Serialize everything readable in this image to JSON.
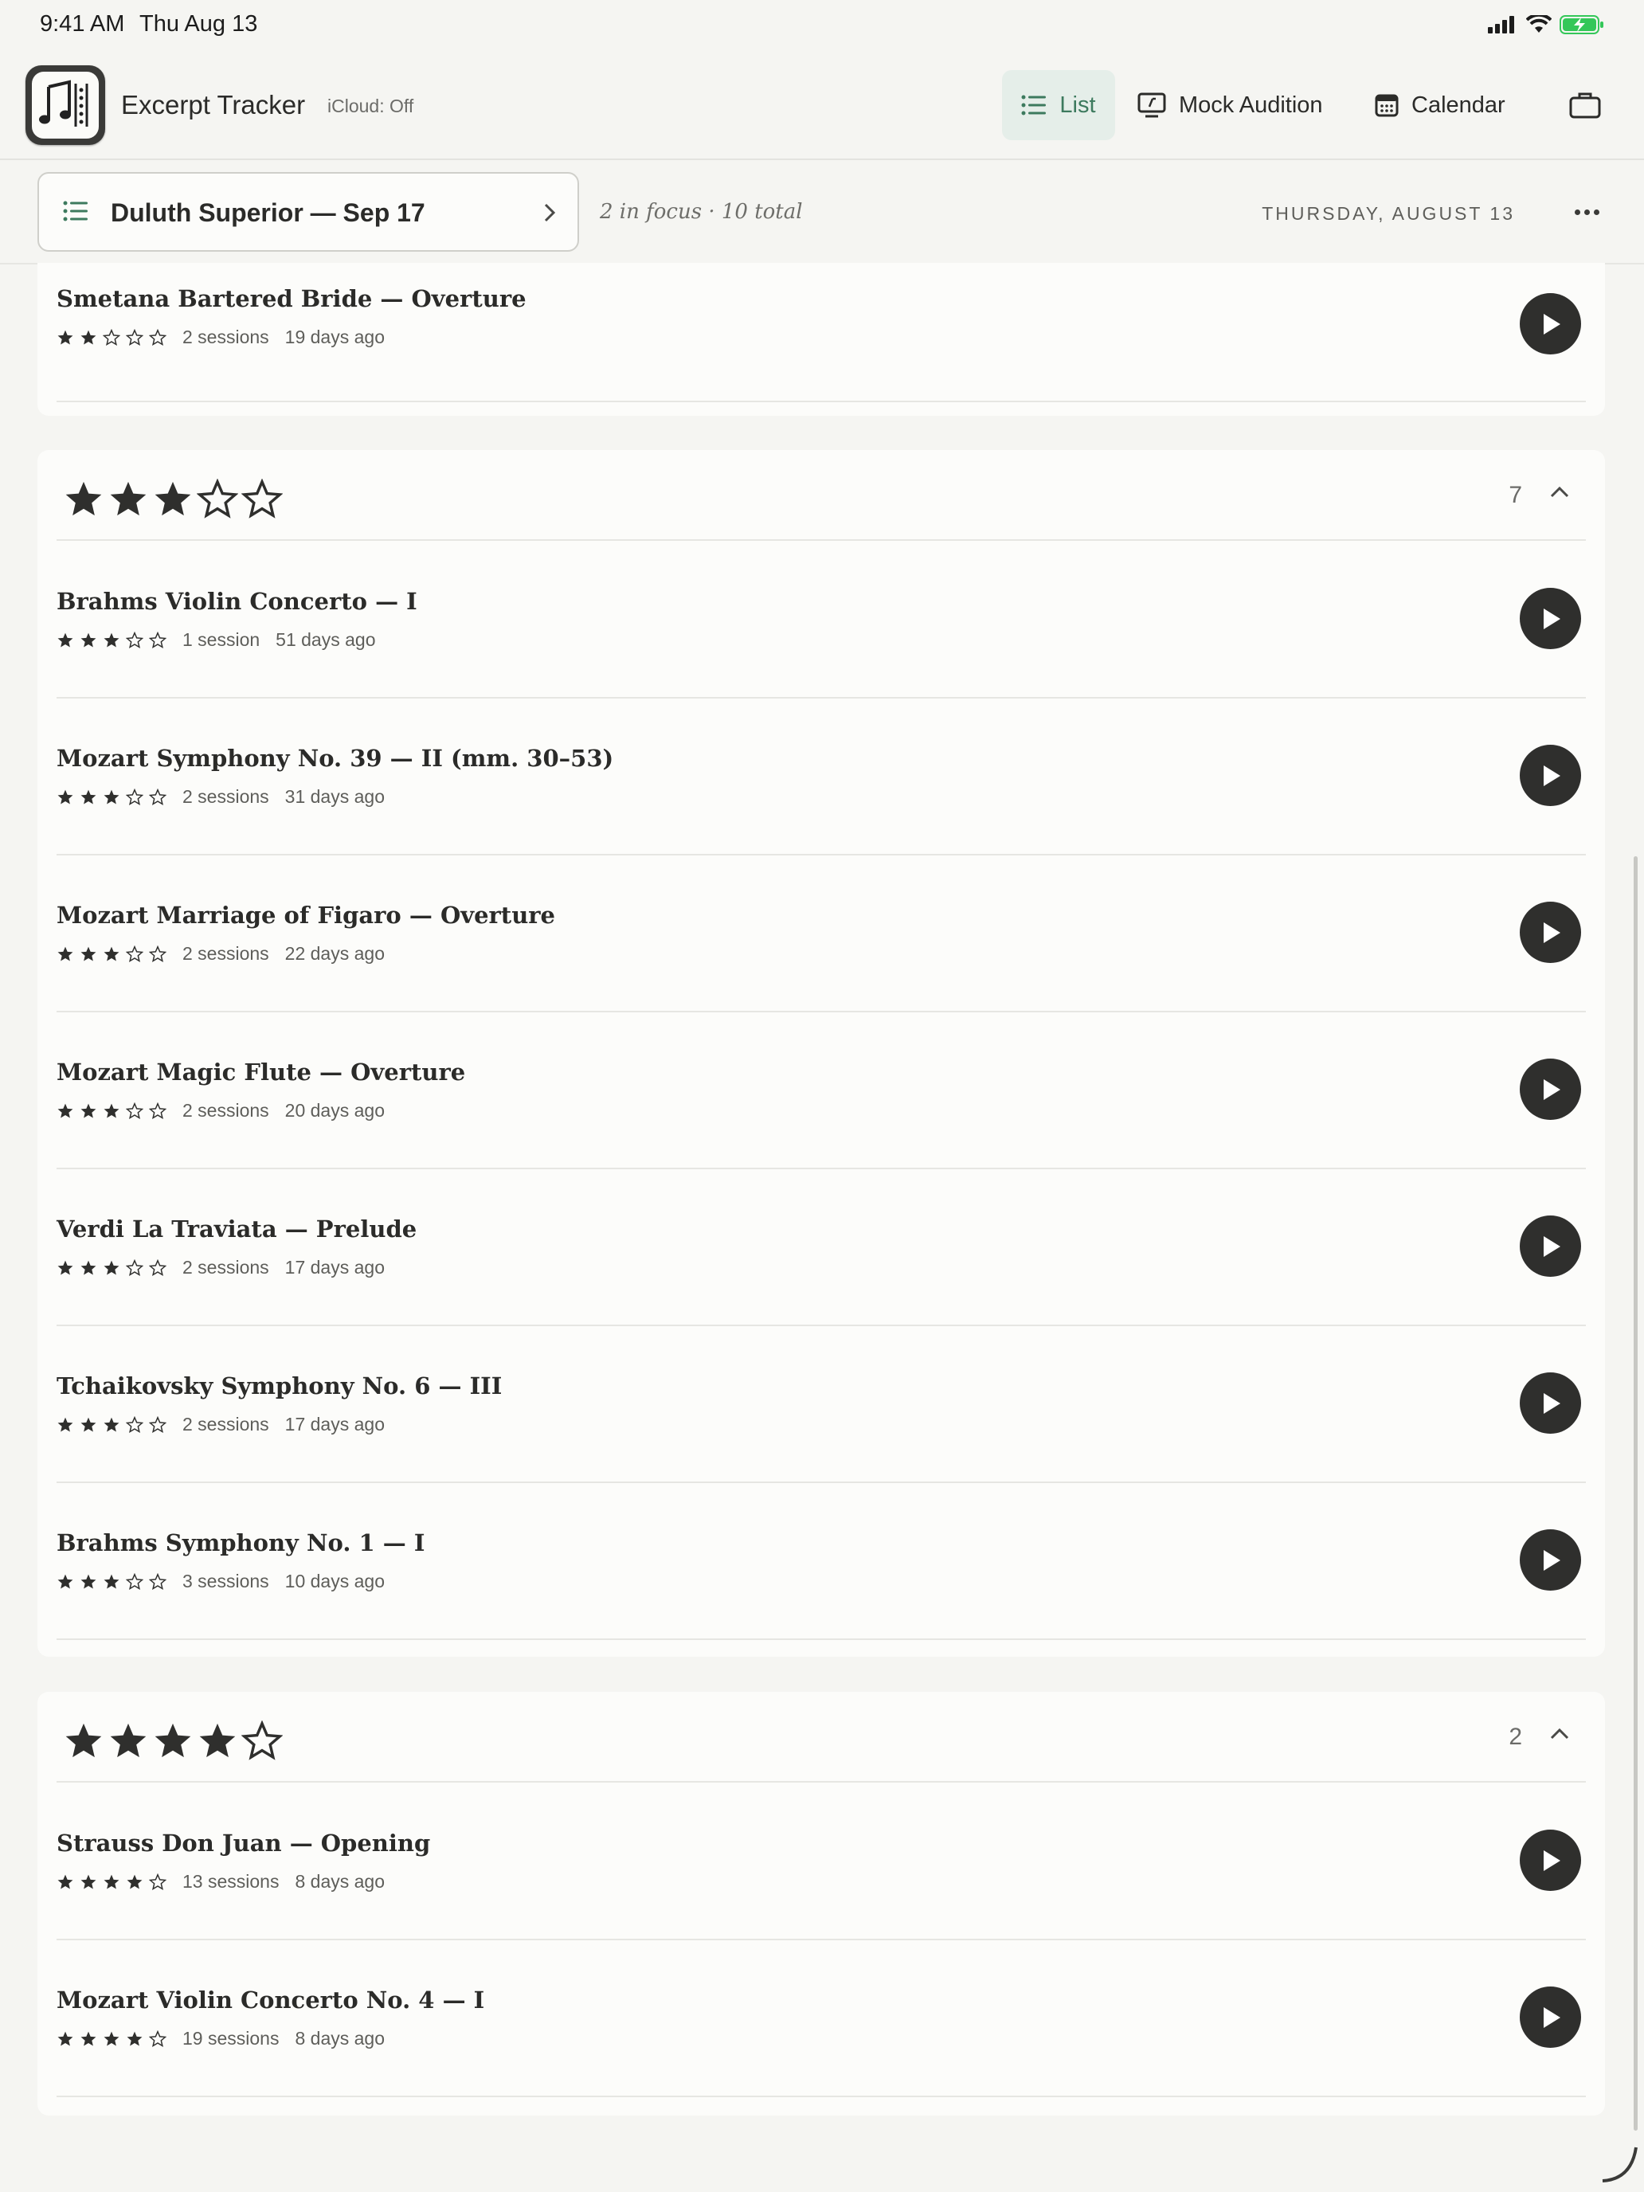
{
  "status_bar": {
    "time": "9:41 AM",
    "date": "Thu Aug 13",
    "battery_color": "#34c759"
  },
  "header": {
    "app_icon": "sheet-music-icon",
    "app_title": "Excerpt Tracker",
    "icloud_status": "iCloud: Off",
    "nav": {
      "list_label": "List",
      "mock_audition_label": "Mock Audition",
      "calendar_label": "Calendar",
      "active": "List",
      "active_color": "#3d7a5e"
    },
    "briefcase_icon": "briefcase-icon"
  },
  "subheader": {
    "list_name": "Duluth Superior — Sep 17",
    "focus_summary": "2 in focus · 10 total",
    "today": "THURSDAY, AUGUST 13"
  },
  "groups": [
    {
      "rating": 2,
      "items": [
        {
          "title": "Smetana Bartered Bride — Overture",
          "stars": 2,
          "sessions": "2 sessions",
          "last": "19 days ago"
        }
      ]
    },
    {
      "rating": 3,
      "count": "7",
      "items": [
        {
          "title": "Brahms Violin Concerto — I",
          "stars": 3,
          "sessions": "1 session",
          "last": "51 days ago"
        },
        {
          "title": "Mozart Symphony No. 39 — II (mm. 30–53)",
          "stars": 3,
          "sessions": "2 sessions",
          "last": "31 days ago"
        },
        {
          "title": "Mozart Marriage of Figaro — Overture",
          "stars": 3,
          "sessions": "2 sessions",
          "last": "22 days ago"
        },
        {
          "title": "Mozart Magic Flute — Overture",
          "stars": 3,
          "sessions": "2 sessions",
          "last": "20 days ago"
        },
        {
          "title": "Verdi La Traviata — Prelude",
          "stars": 3,
          "sessions": "2 sessions",
          "last": "17 days ago"
        },
        {
          "title": "Tchaikovsky Symphony No. 6 — III",
          "stars": 3,
          "sessions": "2 sessions",
          "last": "17 days ago"
        },
        {
          "title": "Brahms Symphony No. 1 — I",
          "stars": 3,
          "sessions": "3 sessions",
          "last": "10 days ago"
        }
      ]
    },
    {
      "rating": 4,
      "count": "2",
      "items": [
        {
          "title": "Strauss Don Juan — Opening",
          "stars": 4,
          "sessions": "13 sessions",
          "last": "8 days ago"
        },
        {
          "title": "Mozart Violin Concerto No. 4 — I",
          "stars": 4,
          "sessions": "19 sessions",
          "last": "8 days ago"
        }
      ]
    }
  ]
}
